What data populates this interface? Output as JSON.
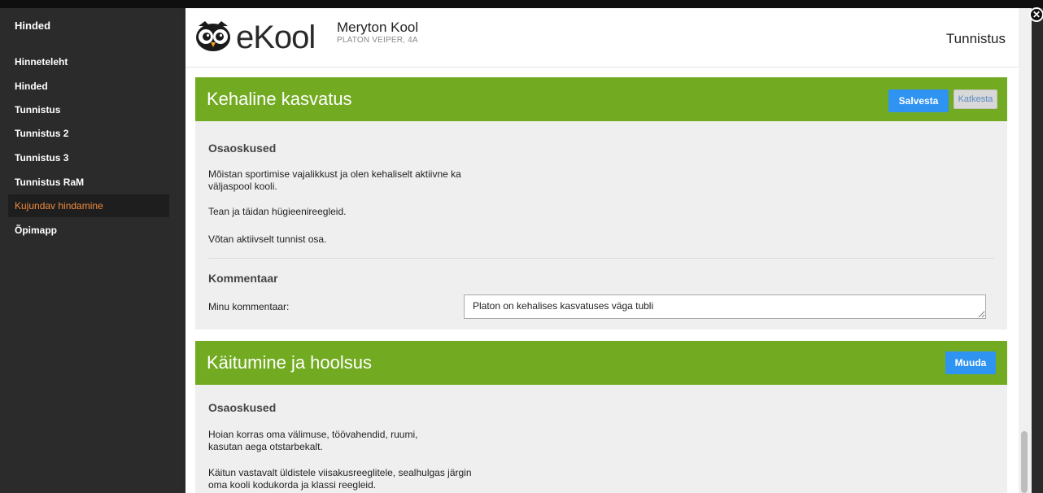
{
  "sidebar": {
    "title": "Hinded",
    "items": [
      {
        "label": "Hinneteleht"
      },
      {
        "label": "Hinded"
      },
      {
        "label": "Tunnistus"
      },
      {
        "label": "Tunnistus 2"
      },
      {
        "label": "Tunnistus 3"
      },
      {
        "label": "Tunnistus RaM"
      },
      {
        "label": "Kujundav hindamine"
      },
      {
        "label": "Õpimapp"
      }
    ],
    "active_item": "Kujundav hindamine"
  },
  "header": {
    "brand": "eKool",
    "school_name": "Meryton Kool",
    "student": "PLATON VEIPER, 4A",
    "page_title": "Tunnistus"
  },
  "sections": [
    {
      "title": "Kehaline kasvatus",
      "save_label": "Salvesta",
      "cancel_label": "Katkesta",
      "subsections_heading": "Osaoskused",
      "skills": [
        "Mõistan sportimise vajalikkust ja olen kehaliselt aktiivne ka väljaspool kooli.",
        "Tean ja täidan hügieenireegleid.",
        "Võtan aktiivselt tunnist osa."
      ],
      "comment_heading": "Kommentaar",
      "comment_label": "Minu kommentaar:",
      "comment_value": "Platon on kehalises kasvatuses väga tubli"
    },
    {
      "title": "Käitumine ja hoolsus",
      "edit_label": "Muuda",
      "subsections_heading": "Osaoskused",
      "skills": [
        "Hoian korras oma välimuse, töövahendid, ruumi, kasutan aega otstarbekalt.",
        "Käitun vastavalt üldistele viisakusreeglitele, sealhulgas järgin oma kooli kodukorda ja klassi reegleid."
      ]
    }
  ],
  "colors": {
    "accent_green": "#72ab21",
    "button_blue": "#2f93f2",
    "active_orange": "#f08a3c"
  },
  "icons": {
    "logo": "owl-logo-icon",
    "close": "close-icon"
  }
}
